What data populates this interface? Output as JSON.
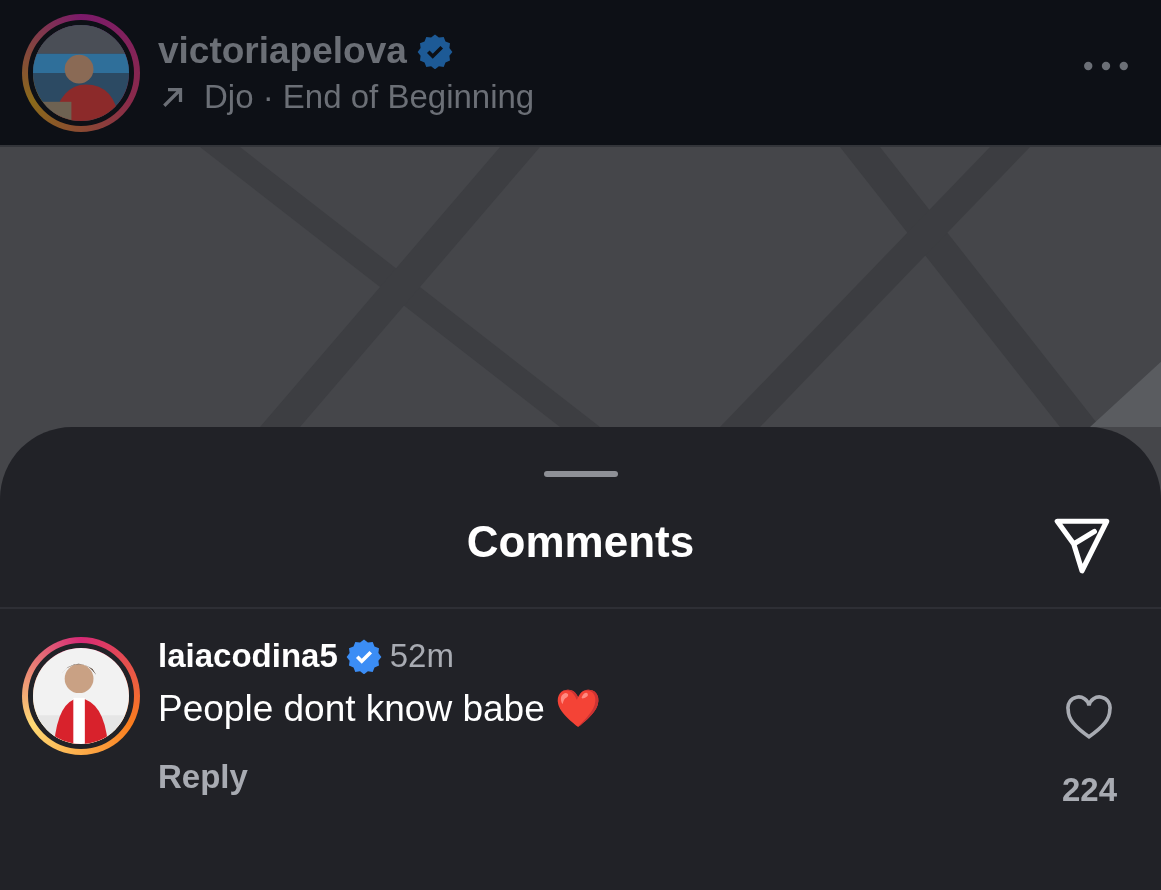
{
  "post": {
    "username": "victoriapelova",
    "verified": true,
    "music": "Djo · End of Beginning",
    "story_ring": true
  },
  "comments_sheet": {
    "title": "Comments",
    "comments": [
      {
        "username": "laiacodina5",
        "verified": true,
        "time": "52m",
        "text": "People dont know babe ❤️",
        "reply": "Reply",
        "likes": "224",
        "liked": false,
        "story_ring": true
      }
    ]
  }
}
